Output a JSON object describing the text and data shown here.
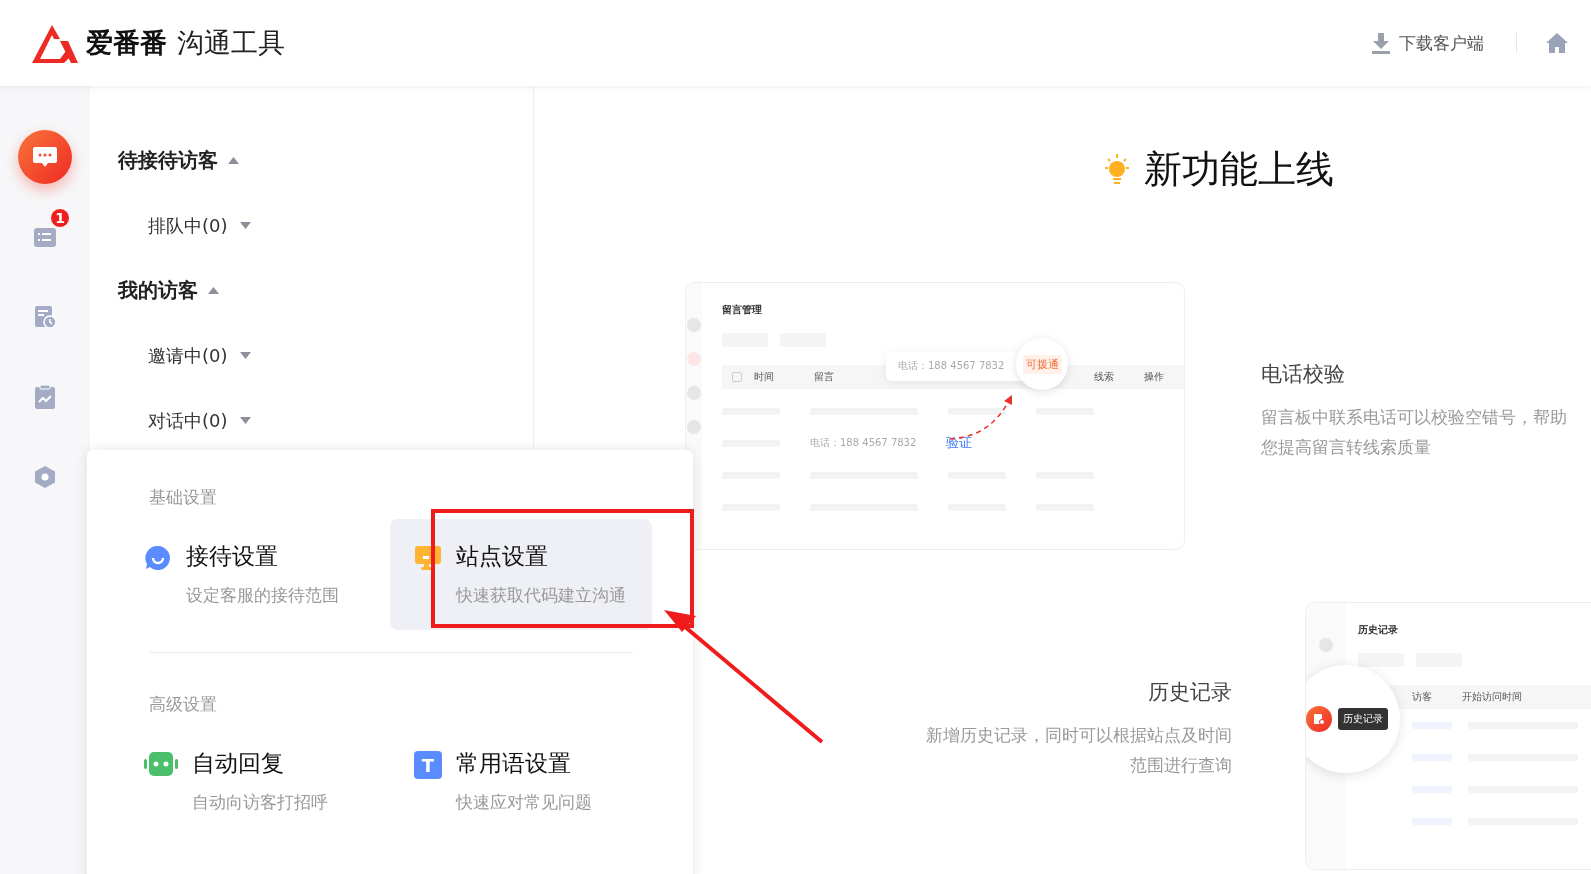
{
  "header": {
    "brand": "爱番番",
    "product": "沟通工具",
    "download": "下载客户端"
  },
  "rail": [
    {
      "kind": "chat",
      "selected": true
    },
    {
      "kind": "list",
      "selected": false,
      "badge": "1"
    },
    {
      "kind": "history",
      "selected": false
    },
    {
      "kind": "report",
      "selected": false
    },
    {
      "kind": "settings",
      "selected": false
    }
  ],
  "visitor_groups": [
    {
      "title": "待接待访客",
      "expanded": true,
      "children": [
        {
          "label": "排队中(0)",
          "expanded": false
        }
      ]
    },
    {
      "title": "我的访客",
      "expanded": true,
      "children": [
        {
          "label": "邀请中(0)",
          "expanded": false
        },
        {
          "label": "对话中(0)",
          "expanded": false
        }
      ]
    }
  ],
  "settings_menu": {
    "sections": [
      {
        "title": "基础设置",
        "items": [
          {
            "kind": "reception",
            "title": "接待设置",
            "desc": "设定客服的接待范围",
            "selected": false
          },
          {
            "kind": "site",
            "title": "站点设置",
            "desc": "快速获取代码建立沟通",
            "selected": true
          }
        ]
      },
      {
        "title": "高级设置",
        "items": [
          {
            "kind": "robot",
            "title": "自动回复",
            "desc": "自动向访客打招呼",
            "selected": false
          },
          {
            "kind": "letter",
            "icon_text": "T",
            "title": "常用语设置",
            "desc": "快速应对常见问题",
            "selected": false
          }
        ]
      }
    ]
  },
  "announcement": {
    "title": "新功能上线",
    "features": [
      {
        "kind": "phone",
        "title": "电话校验",
        "desc": "留言板中联系电话可以校验空错号，帮助您提高留言转线索质量",
        "preview": {
          "title": "留言管理",
          "select_all_checked": false,
          "columns": [
            "时间",
            "留言",
            "线索",
            "操作"
          ],
          "popup_phone": "电话：188 4567 7832",
          "popup_status": "可拨通",
          "row_phone": "电话：188 4567 7832",
          "verify": "验证"
        }
      },
      {
        "kind": "history",
        "title": "历史记录",
        "desc": "新增历史记录，同时可以根据站点及时间范围进行查询",
        "preview": {
          "title": "历史记录",
          "columns": [
            "访客",
            "开始访问时间"
          ],
          "tooltip": "历史记录"
        }
      }
    ]
  }
}
